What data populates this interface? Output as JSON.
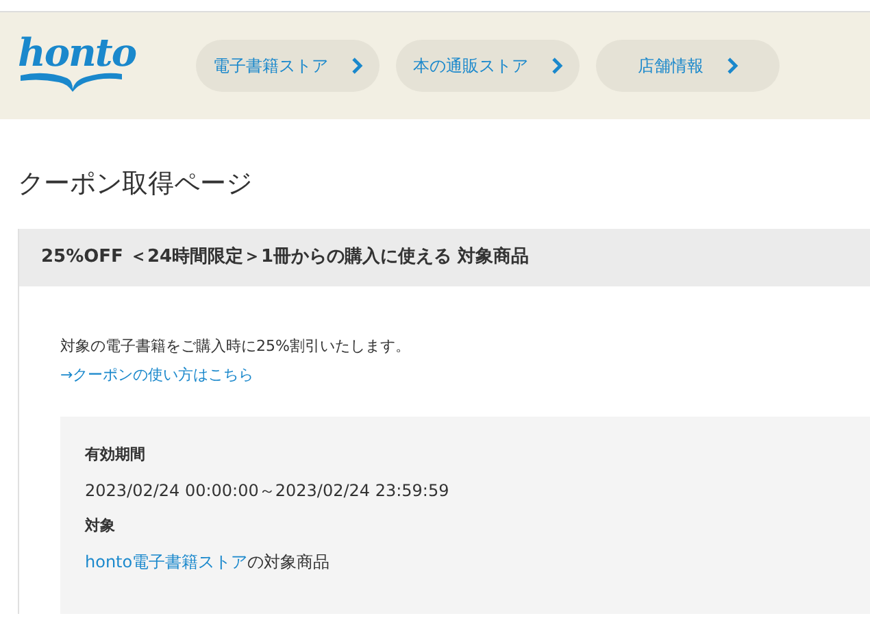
{
  "header": {
    "logo": "honto",
    "nav": [
      {
        "label": "電子書籍ストア"
      },
      {
        "label": "本の通販ストア"
      },
      {
        "label": "店舗情報"
      }
    ]
  },
  "page_title": "クーポン取得ページ",
  "coupon": {
    "title": "25%OFF ＜24時間限定＞1冊からの購入に使える 対象商品",
    "description": "対象の電子書籍をご購入時に25%割引いたします。",
    "help_link": "→クーポンの使い方はこちら",
    "details": [
      {
        "label": "有効期間",
        "value": "2023/02/24 00:00:00～2023/02/24 23:59:59"
      },
      {
        "label": "対象",
        "link": "honto電子書籍ストア",
        "value": "の対象商品"
      }
    ]
  }
}
